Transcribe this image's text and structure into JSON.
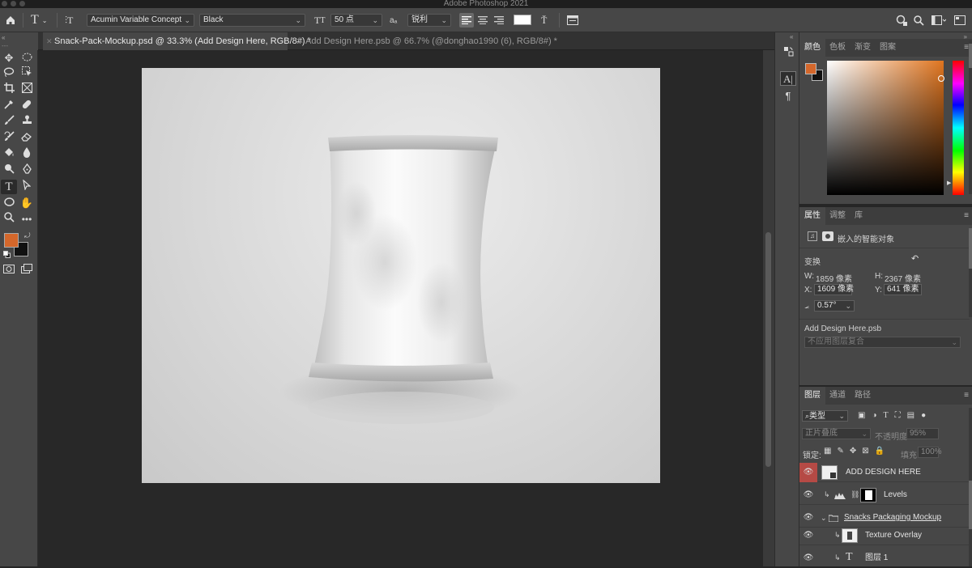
{
  "app": {
    "title": "Adobe Photoshop 2021"
  },
  "options_bar": {
    "home_icon": "home-icon",
    "type_tool_icon": "type-tool-icon",
    "font_family": "Acumin Variable Concept",
    "font_style": "Black",
    "font_size": "50 点",
    "aa_label": "aₐ",
    "antialias": "锐利",
    "text_color": "#ffffff"
  },
  "tabs": [
    {
      "label": "Snack-Pack-Mockup.psd @ 33.3% (Add Design Here, RGB/8#) *",
      "active": true
    },
    {
      "label": "Add Design Here.psb @ 66.7% (@donghao1990 (6), RGB/8#) *",
      "active": false
    }
  ],
  "colors": {
    "foreground": "#d4672b",
    "background": "#111111",
    "accent_hue": "#e0751f"
  },
  "color_panel": {
    "tabs": [
      "颜色",
      "色板",
      "渐变",
      "图案"
    ]
  },
  "properties_panel": {
    "tabs": [
      "属性",
      "调整",
      "库"
    ],
    "kind_label": "嵌入的智能对象",
    "section_transform": "变换",
    "w_label": "W:",
    "w_value": "1859 像素",
    "h_label": "H:",
    "h_value": "2367 像素",
    "x_label": "X:",
    "x_value": "1609 像素",
    "y_label": "Y:",
    "y_value": "641 像素",
    "angle_value": "0.57°",
    "linked_file": "Add Design Here.psb",
    "comp_placeholder": "不应用图层复合"
  },
  "layers_panel": {
    "tabs": [
      "图层",
      "通道",
      "路径"
    ],
    "filter_label": "类型",
    "blend_mode": "正片叠底",
    "opacity_label": "不透明度:",
    "opacity_value": "95%",
    "lock_label": "锁定:",
    "fill_label": "填充:",
    "fill_value": "100%",
    "layers": [
      {
        "name": "ADD DESIGN HERE"
      },
      {
        "name": "Levels"
      },
      {
        "name": "Snacks Packaging Mockup"
      },
      {
        "name": "Texture Overlay"
      },
      {
        "name": "图层 1"
      }
    ]
  }
}
